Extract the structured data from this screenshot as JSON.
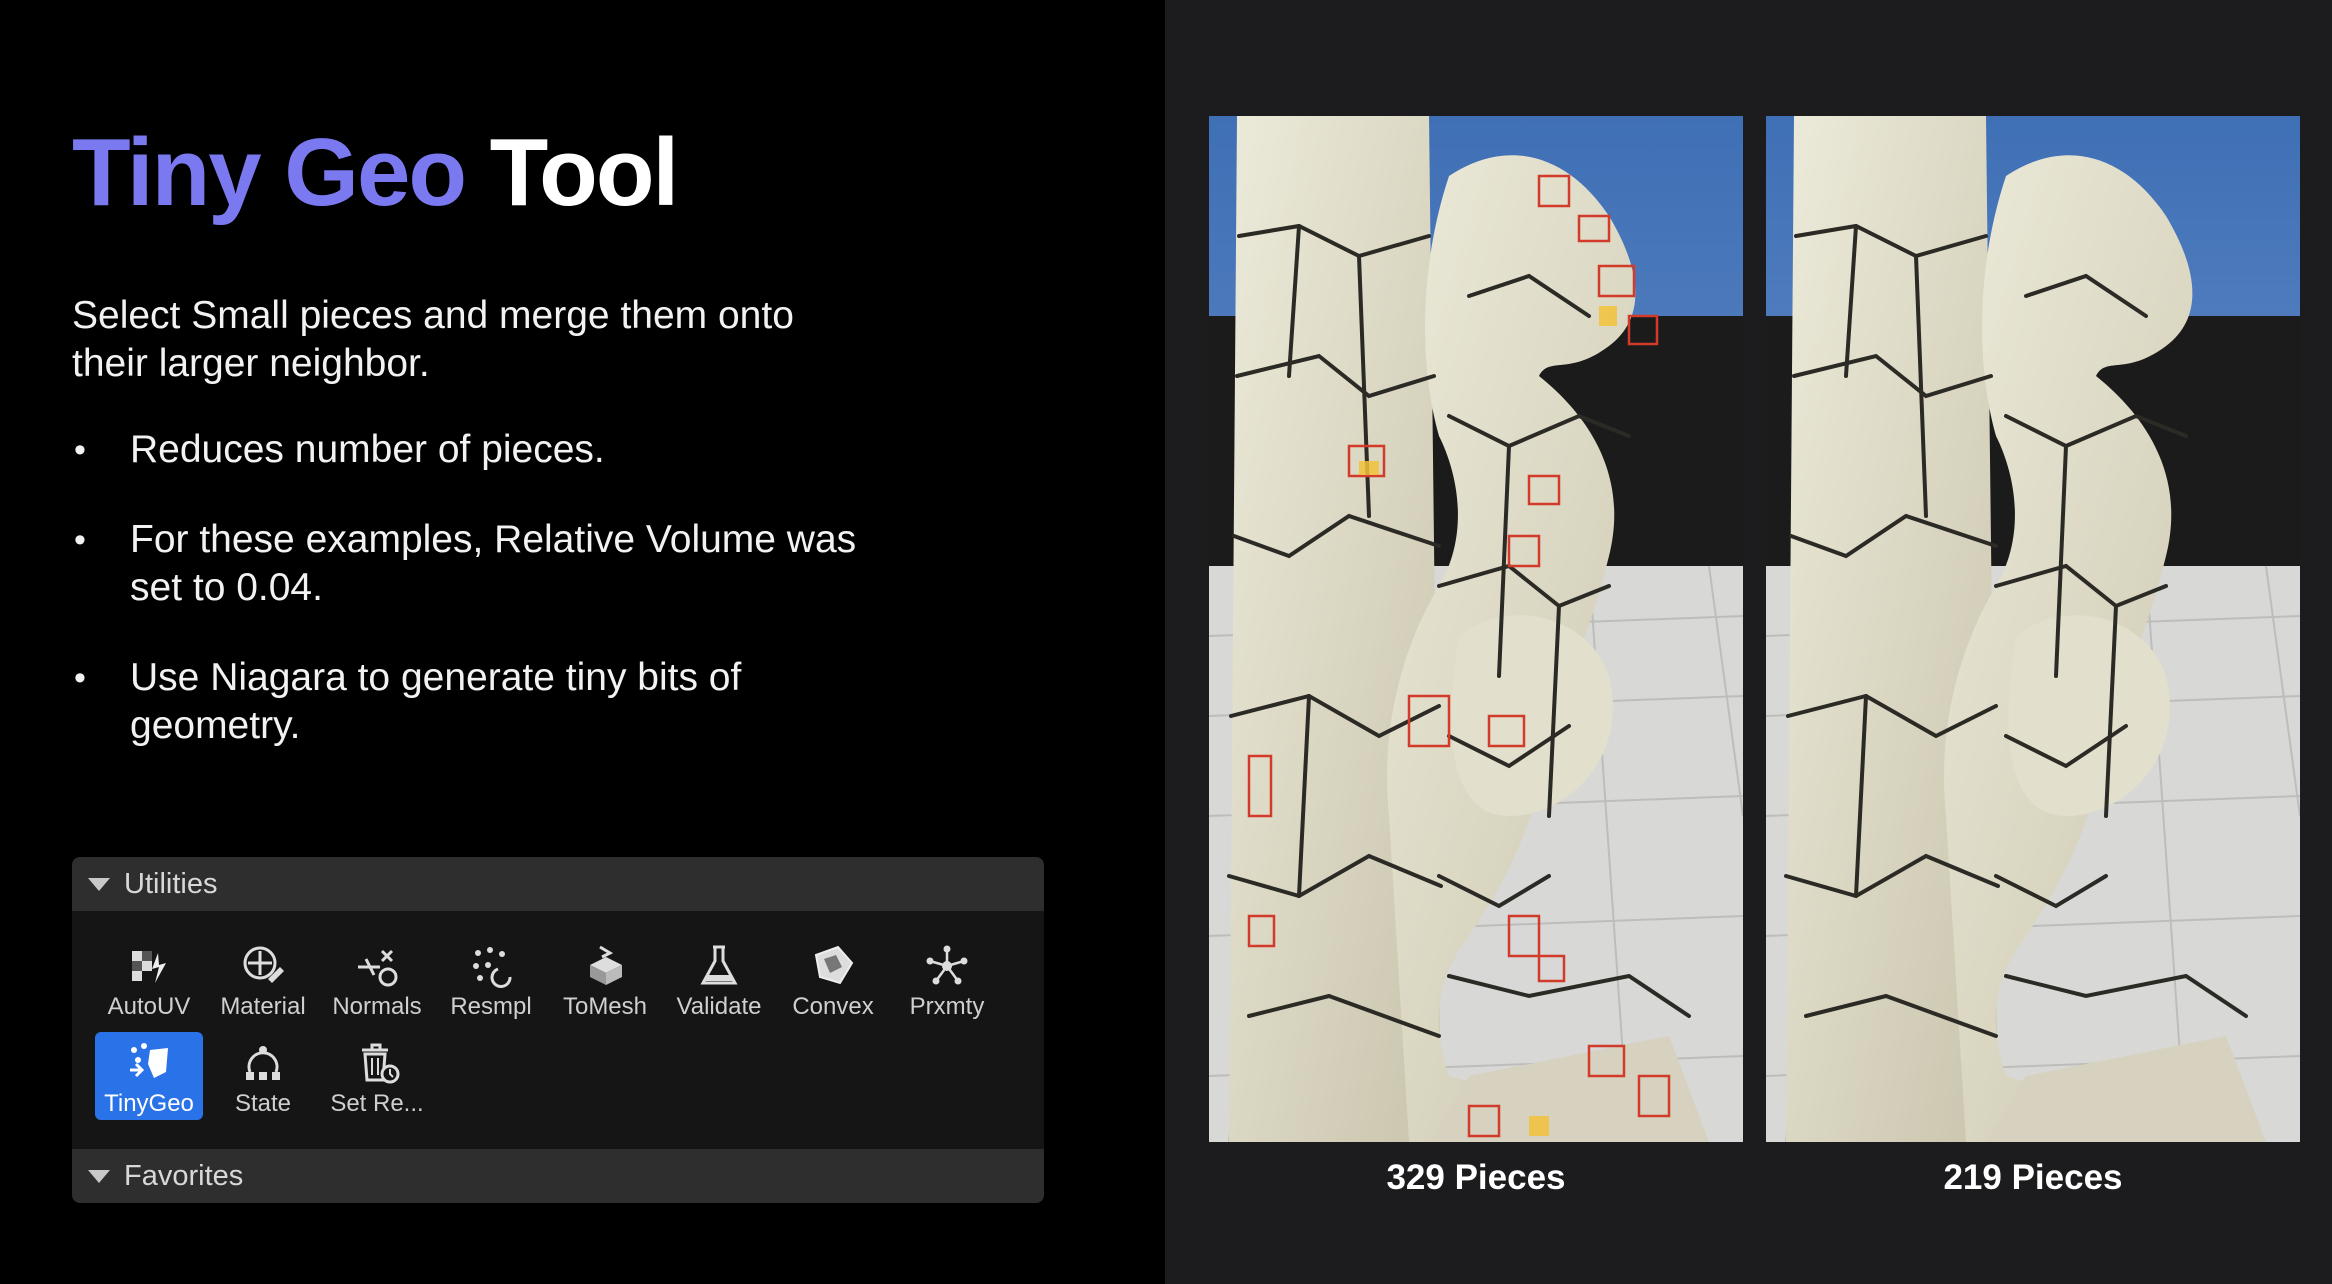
{
  "slide": {
    "title_accent": "Tiny Geo",
    "title_rest": "Tool",
    "intro": "Select Small pieces and merge them onto their larger neighbor.",
    "bullets": [
      "Reduces number of pieces.",
      "For these examples, Relative Volume was set to 0.04.",
      "Use Niagara to generate tiny bits of geometry."
    ],
    "colors": {
      "accent": "#7b79f0",
      "active_tool": "#2a72e8"
    }
  },
  "panel": {
    "utilities_label": "Utilities",
    "favorites_label": "Favorites",
    "tools": [
      {
        "label": "AutoUV",
        "icon": "auto-uv-icon"
      },
      {
        "label": "Material",
        "icon": "material-icon"
      },
      {
        "label": "Normals",
        "icon": "normals-icon"
      },
      {
        "label": "Resmpl",
        "icon": "resample-icon"
      },
      {
        "label": "ToMesh",
        "icon": "to-mesh-icon"
      },
      {
        "label": "Validate",
        "icon": "flask-icon"
      },
      {
        "label": "Convex",
        "icon": "convex-icon"
      },
      {
        "label": "Prxmty",
        "icon": "proximity-icon"
      },
      {
        "label": "TinyGeo",
        "icon": "tiny-geo-icon",
        "selected": true
      },
      {
        "label": "State",
        "icon": "state-icon"
      },
      {
        "label": "Set Re...",
        "icon": "set-remove-icon"
      }
    ]
  },
  "comparison": {
    "left_caption": "329 Pieces",
    "right_caption": "219 Pieces"
  }
}
